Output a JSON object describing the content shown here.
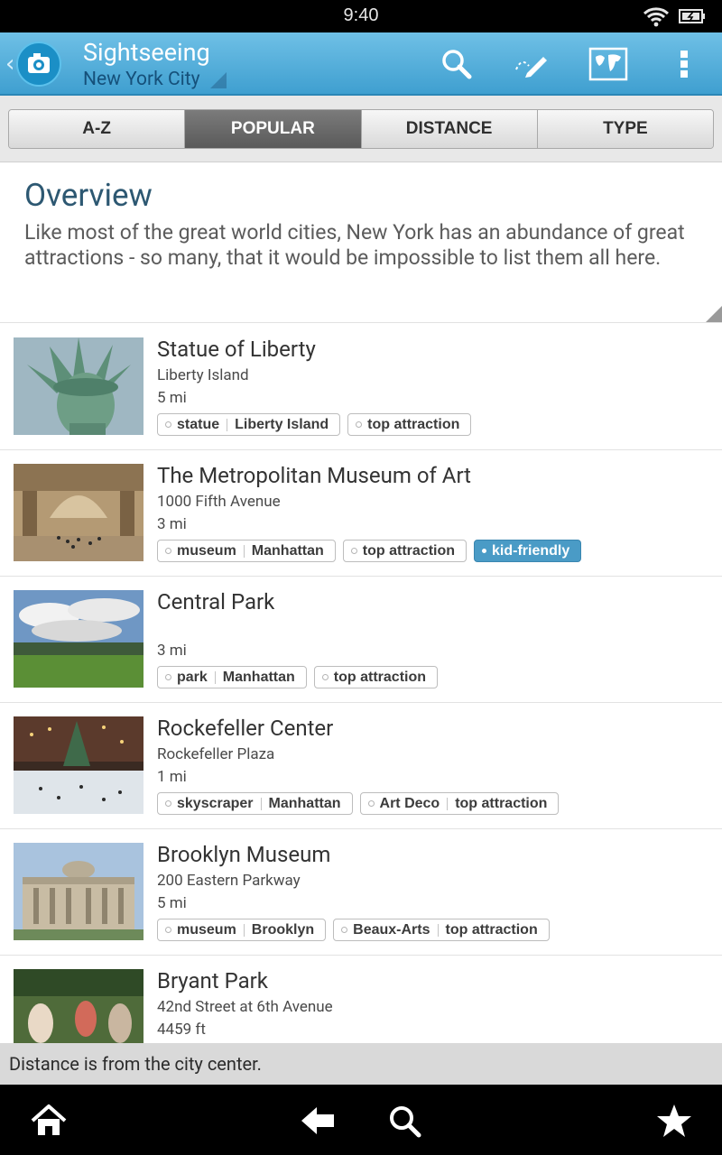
{
  "status_bar": {
    "time": "9:40"
  },
  "header": {
    "title": "Sightseeing",
    "subtitle": "New York City"
  },
  "tabs": [
    {
      "label": "A-Z",
      "active": false
    },
    {
      "label": "POPULAR",
      "active": true
    },
    {
      "label": "DISTANCE",
      "active": false
    },
    {
      "label": "TYPE",
      "active": false
    }
  ],
  "overview": {
    "heading": "Overview",
    "text": "Like most of the great world cities, New York has an abundance of great attractions - so many, that it would be impossible to list them all here."
  },
  "attractions": [
    {
      "name": "Statue of Liberty",
      "address": "Liberty Island",
      "distance": "5 mi",
      "tags": [
        {
          "parts": [
            "statue",
            "Liberty Island"
          ],
          "highlight": false
        },
        {
          "parts": [
            "top attraction"
          ],
          "highlight": false
        }
      ]
    },
    {
      "name": "The Metropolitan Museum of Art",
      "address": "1000 Fifth Avenue",
      "distance": "3 mi",
      "tags": [
        {
          "parts": [
            "museum",
            "Manhattan"
          ],
          "highlight": false
        },
        {
          "parts": [
            "top attraction"
          ],
          "highlight": false
        },
        {
          "parts": [
            "kid-friendly"
          ],
          "highlight": true
        }
      ]
    },
    {
      "name": "Central Park",
      "address": "",
      "distance": "3 mi",
      "tags": [
        {
          "parts": [
            "park",
            "Manhattan"
          ],
          "highlight": false
        },
        {
          "parts": [
            "top attraction"
          ],
          "highlight": false
        }
      ]
    },
    {
      "name": "Rockefeller Center",
      "address": "Rockefeller Plaza",
      "distance": "1 mi",
      "tags": [
        {
          "parts": [
            "skyscraper",
            "Manhattan"
          ],
          "highlight": false
        },
        {
          "parts": [
            "Art Deco",
            "top attraction"
          ],
          "highlight": false
        }
      ]
    },
    {
      "name": "Brooklyn Museum",
      "address": "200 Eastern Parkway",
      "distance": "5 mi",
      "tags": [
        {
          "parts": [
            "museum",
            "Brooklyn"
          ],
          "highlight": false
        },
        {
          "parts": [
            "Beaux-Arts",
            "top attraction"
          ],
          "highlight": false
        }
      ]
    },
    {
      "name": "Bryant Park",
      "address": "42nd Street at 6th Avenue",
      "distance": "4459 ft",
      "tags": []
    }
  ],
  "footer_note": "Distance is from the city center.",
  "colors": {
    "accent": "#3f9fd0",
    "title_blue": "#2d5872",
    "highlight_tag": "#4a9bc6"
  },
  "icons": [
    "camera-logo-icon",
    "search-icon",
    "edit-icon",
    "world-map-icon",
    "overflow-menu-icon",
    "home-icon",
    "back-arrow-icon",
    "search-icon",
    "star-icon"
  ]
}
